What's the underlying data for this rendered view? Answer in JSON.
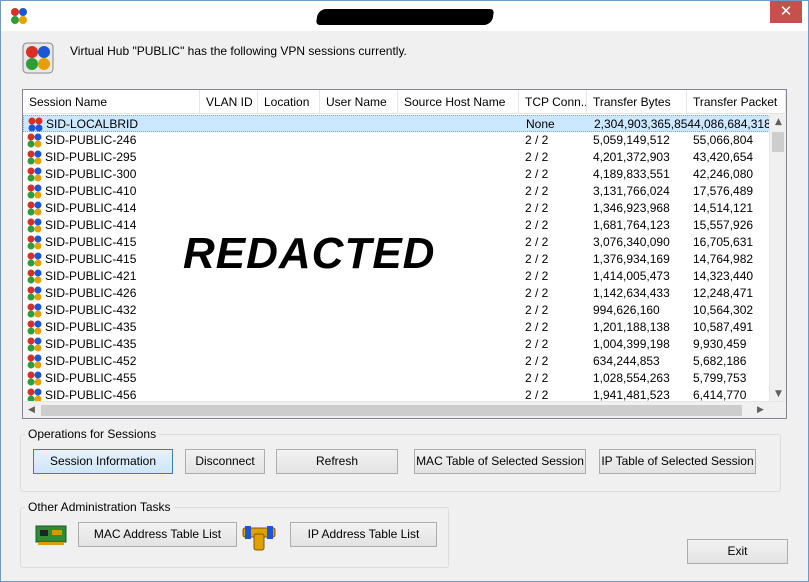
{
  "header": {
    "message": "Virtual Hub \"PUBLIC\" has the following VPN sessions currently."
  },
  "window": {
    "close_glyph": "✕"
  },
  "columns": [
    "Session Name",
    "VLAN ID",
    "Location",
    "User Name",
    "Source Host Name",
    "TCP Conn...",
    "Transfer Bytes",
    "Transfer Packet"
  ],
  "sessions": [
    {
      "name": "SID-LOCALBRID",
      "tcp": "None",
      "bytes": "2,304,903,365,854",
      "packets": "4,086,684,318",
      "icon": "bridge-session-icon"
    },
    {
      "name": "SID-PUBLIC-246",
      "tcp": "2 / 2",
      "bytes": "5,059,149,512",
      "packets": "55,066,804",
      "icon": "user-session-icon"
    },
    {
      "name": "SID-PUBLIC-295",
      "tcp": "2 / 2",
      "bytes": "4,201,372,903",
      "packets": "43,420,654",
      "icon": "user-session-icon"
    },
    {
      "name": "SID-PUBLIC-300",
      "tcp": "2 / 2",
      "bytes": "4,189,833,551",
      "packets": "42,246,080",
      "icon": "user-session-icon"
    },
    {
      "name": "SID-PUBLIC-410",
      "tcp": "2 / 2",
      "bytes": "3,131,766,024",
      "packets": "17,576,489",
      "icon": "user-session-icon"
    },
    {
      "name": "SID-PUBLIC-414",
      "tcp": "2 / 2",
      "bytes": "1,346,923,968",
      "packets": "14,514,121",
      "icon": "user-session-icon"
    },
    {
      "name": "SID-PUBLIC-414",
      "tcp": "2 / 2",
      "bytes": "1,681,764,123",
      "packets": "15,557,926",
      "icon": "user-session-icon"
    },
    {
      "name": "SID-PUBLIC-415",
      "tcp": "2 / 2",
      "bytes": "3,076,340,090",
      "packets": "16,705,631",
      "icon": "user-session-icon"
    },
    {
      "name": "SID-PUBLIC-415",
      "tcp": "2 / 2",
      "bytes": "1,376,934,169",
      "packets": "14,764,982",
      "icon": "user-session-icon"
    },
    {
      "name": "SID-PUBLIC-421",
      "tcp": "2 / 2",
      "bytes": "1,414,005,473",
      "packets": "14,323,440",
      "icon": "user-session-icon"
    },
    {
      "name": "SID-PUBLIC-426",
      "tcp": "2 / 2",
      "bytes": "1,142,634,433",
      "packets": "12,248,471",
      "icon": "user-session-icon"
    },
    {
      "name": "SID-PUBLIC-432",
      "tcp": "2 / 2",
      "bytes": "994,626,160",
      "packets": "10,564,302",
      "icon": "user-session-icon"
    },
    {
      "name": "SID-PUBLIC-435",
      "tcp": "2 / 2",
      "bytes": "1,201,188,138",
      "packets": "10,587,491",
      "icon": "user-session-icon"
    },
    {
      "name": "SID-PUBLIC-435",
      "tcp": "2 / 2",
      "bytes": "1,004,399,198",
      "packets": "9,930,459",
      "icon": "user-session-icon"
    },
    {
      "name": "SID-PUBLIC-452",
      "tcp": "2 / 2",
      "bytes": "634,244,853",
      "packets": "5,682,186",
      "icon": "user-session-icon"
    },
    {
      "name": "SID-PUBLIC-455",
      "tcp": "2 / 2",
      "bytes": "1,028,554,263",
      "packets": "5,799,753",
      "icon": "user-session-icon"
    },
    {
      "name": "SID-PUBLIC-456",
      "tcp": "2 / 2",
      "bytes": "1,941,481,523",
      "packets": "6,414,770",
      "icon": "user-session-icon"
    }
  ],
  "overlay": {
    "redacted_text": "REDACTED"
  },
  "operations": {
    "legend": "Operations for Sessions",
    "buttons": [
      "Session Information",
      "Disconnect",
      "Refresh",
      "MAC Table of Selected Session",
      "IP Table of Selected Session"
    ]
  },
  "admin": {
    "legend": "Other Administration Tasks",
    "buttons": [
      "MAC Address Table List",
      "IP Address Table List"
    ]
  },
  "exit_label": "Exit",
  "scroll_glyphs": {
    "up": "▲",
    "down": "▼",
    "left": "◀",
    "right": "▶"
  }
}
